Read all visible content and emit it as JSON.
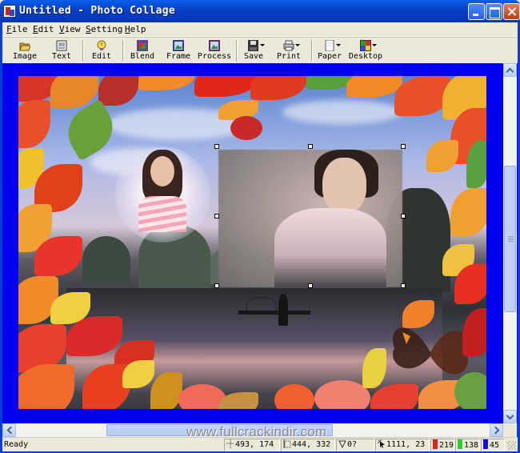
{
  "window": {
    "title": "Untitled - Photo Collage",
    "controls": [
      "minimize",
      "maximize",
      "close"
    ]
  },
  "menubar": {
    "items": [
      {
        "label": "File"
      },
      {
        "label": "Edit"
      },
      {
        "label": "View"
      },
      {
        "label": "Setting"
      },
      {
        "label": "Help"
      }
    ]
  },
  "toolbar": {
    "buttons": [
      {
        "label": "Image",
        "icon": "folder-open-icon"
      },
      {
        "label": "Text",
        "icon": "text-frame-icon"
      },
      {
        "label": "Edit",
        "icon": "lightbulb-icon"
      },
      {
        "label": "Blend",
        "icon": "blend-icon"
      },
      {
        "label": "Frame",
        "icon": "frame-icon"
      },
      {
        "label": "Process",
        "icon": "process-icon"
      },
      {
        "label": "Save",
        "icon": "floppy-disk-icon",
        "dropdown": true
      },
      {
        "label": "Print",
        "icon": "printer-icon",
        "dropdown": true
      },
      {
        "label": "Paper",
        "icon": "paper-icon",
        "dropdown": true
      },
      {
        "label": "Desktop",
        "icon": "desktop-icon",
        "dropdown": true
      }
    ]
  },
  "canvas": {
    "background_color": "#0000f0",
    "collage": {
      "frame": "autumn leaves border",
      "scene": "lake with mountains and fisherman at dusk",
      "layers": [
        "woman in pink striped top (circular vignette)",
        "woman in white blouse (selected, soft edge)",
        "butterfly"
      ]
    },
    "selection": {
      "active": true,
      "handles": 8
    }
  },
  "watermark": "www.fullcrackindir.com",
  "statusbar": {
    "status": "Ready",
    "position": "493, 174",
    "size": "444, 332",
    "angle": "0?",
    "cursor": "1111, 23",
    "rgb": {
      "r": "219",
      "g": "138",
      "b": "45",
      "colors": {
        "r": "#e02020",
        "g": "#30d030",
        "b": "#1010d0"
      }
    }
  }
}
